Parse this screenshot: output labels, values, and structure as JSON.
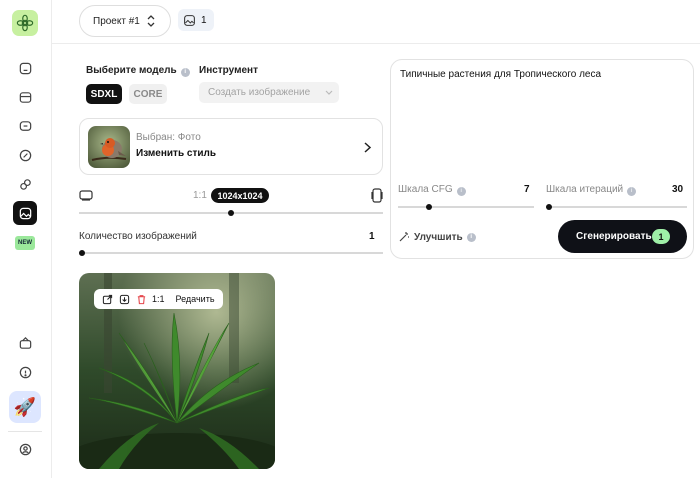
{
  "sidebar": {
    "new_badge": "NEW",
    "icons": [
      "home-icon",
      "archive-icon",
      "chat-icon",
      "edit-icon",
      "link-icon",
      "image-icon",
      "settings-icon",
      "help-icon",
      "rocket-icon",
      "user-icon"
    ]
  },
  "topbar": {
    "project_label": "Проект #1",
    "image_count": "1"
  },
  "model": {
    "label": "Выберите модель",
    "options": [
      "SDXL",
      "CORE"
    ],
    "selected": "SDXL"
  },
  "tool": {
    "label": "Инструмент",
    "placeholder": "Создать изображение"
  },
  "style": {
    "selected_label": "Выбран: Фото",
    "change_label": "Изменить стиль"
  },
  "ratio": {
    "ratio_text": "1:1",
    "size_text": "1024x1024",
    "slider_fraction": 0.5
  },
  "image_count": {
    "label": "Количество изображений",
    "value": "1",
    "slider_fraction": 0.0
  },
  "prompt": {
    "text": "Типичные растения для Тропического леса"
  },
  "cfg": {
    "label": "Шкала CFG",
    "value": "7"
  },
  "iterations": {
    "label": "Шкала итераций",
    "value": "30"
  },
  "improve_label": "Улучшить",
  "generate": {
    "label": "Сгенерировать",
    "badge": "1"
  },
  "result": {
    "ratio_label": "1:1",
    "edit_label": "Редачить"
  },
  "colors": {
    "accent_dark": "#0f1117",
    "badge_green": "#9ff0a8",
    "logo_green": "#c7f0a0",
    "delete_red": "#e5484d"
  }
}
